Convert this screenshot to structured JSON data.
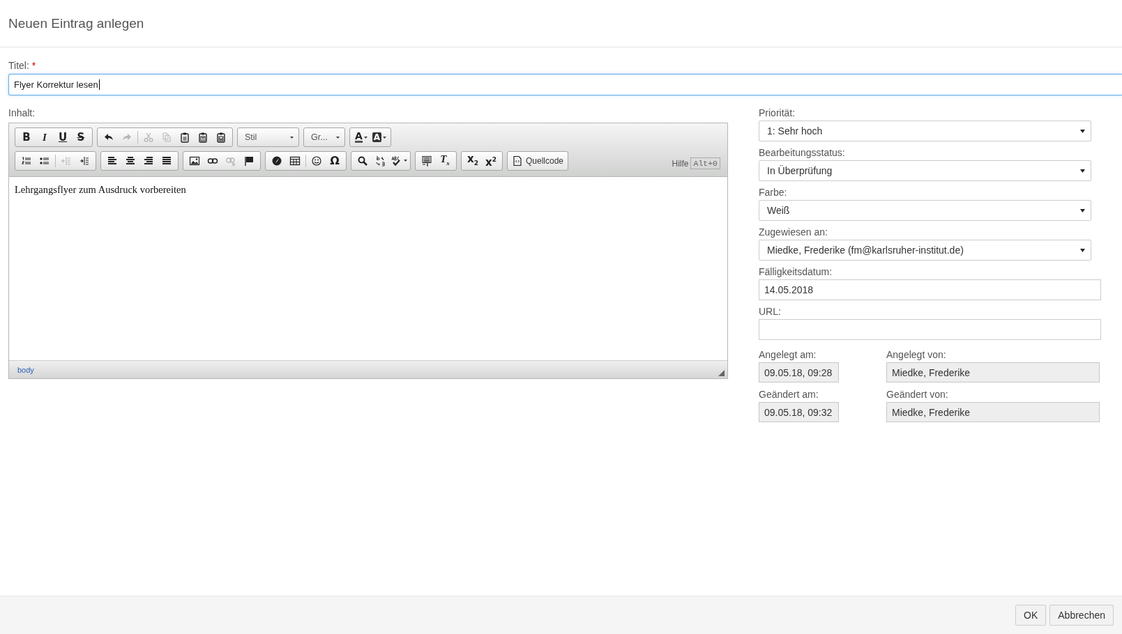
{
  "dialog": {
    "title": "Neuen Eintrag anlegen"
  },
  "title_field": {
    "label": "Titel:",
    "required_mark": "*",
    "value": "Flyer Korrektur lesen",
    "focused": true
  },
  "content": {
    "label": "Inhalt:",
    "toolbar": [
      [
        [
          {
            "kind": "glyph",
            "glyph": "B",
            "disabled": false
          },
          {
            "kind": "glyph",
            "glyph": "I",
            "disabled": false
          },
          {
            "kind": "glyph",
            "glyph": "U",
            "disabled": false
          },
          {
            "kind": "glyph",
            "glyph": "S",
            "disabled": false
          }
        ],
        [
          {
            "kind": "icon",
            "disabled": false
          },
          {
            "kind": "icon",
            "disabled": true
          },
          {
            "kind": "separator"
          },
          {
            "kind": "icon",
            "disabled": true
          },
          {
            "kind": "icon",
            "disabled": true
          },
          {
            "kind": "icon",
            "disabled": false
          },
          {
            "kind": "icon",
            "disabled": false
          },
          {
            "kind": "icon",
            "disabled": false
          }
        ],
        [
          {
            "kind": "combo",
            "label": "Stil"
          }
        ],
        [
          {
            "kind": "combo",
            "label": "Gr..."
          }
        ],
        [
          {
            "kind": "glyph",
            "glyph": "A",
            "dropdown": true,
            "disabled": false
          },
          {
            "kind": "glyph",
            "glyph": "A",
            "dropdown": true,
            "disabled": false
          }
        ]
      ],
      [
        [
          {
            "kind": "icon",
            "disabled": false
          },
          {
            "kind": "icon",
            "disabled": false
          },
          {
            "kind": "separator"
          },
          {
            "kind": "icon",
            "disabled": true
          },
          {
            "kind": "icon",
            "disabled": false
          }
        ],
        [
          {
            "kind": "icon",
            "disabled": false
          },
          {
            "kind": "icon",
            "disabled": false
          },
          {
            "kind": "icon",
            "disabled": false
          },
          {
            "kind": "icon",
            "disabled": false
          }
        ],
        [
          {
            "kind": "icon",
            "disabled": false
          },
          {
            "kind": "icon",
            "disabled": false
          },
          {
            "kind": "icon",
            "disabled": true
          },
          {
            "kind": "icon",
            "disabled": false
          }
        ],
        [
          {
            "kind": "icon",
            "disabled": false
          },
          {
            "kind": "icon",
            "disabled": false
          },
          {
            "kind": "separator"
          },
          {
            "kind": "icon",
            "disabled": false
          },
          {
            "kind": "glyph",
            "glyph": "Ω",
            "disabled": false
          }
        ],
        [
          {
            "kind": "icon",
            "disabled": false
          },
          {
            "kind": "icon",
            "disabled": false
          },
          {
            "kind": "icon",
            "dropdown": true,
            "disabled": false
          }
        ],
        [
          {
            "kind": "icon",
            "disabled": false
          },
          {
            "kind": "glyph",
            "glyph": "T$_{x}$",
            "disabled": false
          }
        ],
        [
          {
            "kind": "glyph",
            "glyph": "x$_{2}$",
            "disabled": false
          },
          {
            "kind": "glyph",
            "glyph": "x$^{2}$",
            "disabled": false
          }
        ],
        [
          {
            "kind": "text",
            "label": "Quellcode",
            "disabled": false
          }
        ]
      ]
    ],
    "help": {
      "label": "Hilfe",
      "shortcut": "Alt+0"
    },
    "body_text": "Lehrgangsflyer zum Ausdruck vorbereiten",
    "path": "body"
  },
  "fields": [
    {
      "kind": "select",
      "label": "Priorität:",
      "value": "1: Sehr hoch"
    },
    {
      "kind": "select",
      "label": "Bearbeitungsstatus:",
      "value": "In Überprüfung"
    },
    {
      "kind": "select",
      "label": "Farbe:",
      "value": "Weiß"
    },
    {
      "kind": "select",
      "label": "Zugewiesen an:",
      "value": "Miedke, Frederike (fm@karlsruher-institut.de)"
    },
    {
      "kind": "input",
      "label": "Fälligkeitsdatum:",
      "value": "14.05.2018"
    },
    {
      "kind": "input",
      "label": "URL:"
    }
  ],
  "meta": [
    {
      "label": "Angelegt am:",
      "value": "09.05.18, 09:28"
    },
    {
      "label": "Angelegt von:",
      "value": "Miedke, Frederike"
    },
    {
      "label": "Geändert am:",
      "value": "09.05.18, 09:32"
    },
    {
      "label": "Geändert von:",
      "value": "Miedke, Frederike"
    }
  ],
  "buttons": [
    {
      "label": "OK"
    },
    {
      "label": "Abbrechen"
    }
  ]
}
